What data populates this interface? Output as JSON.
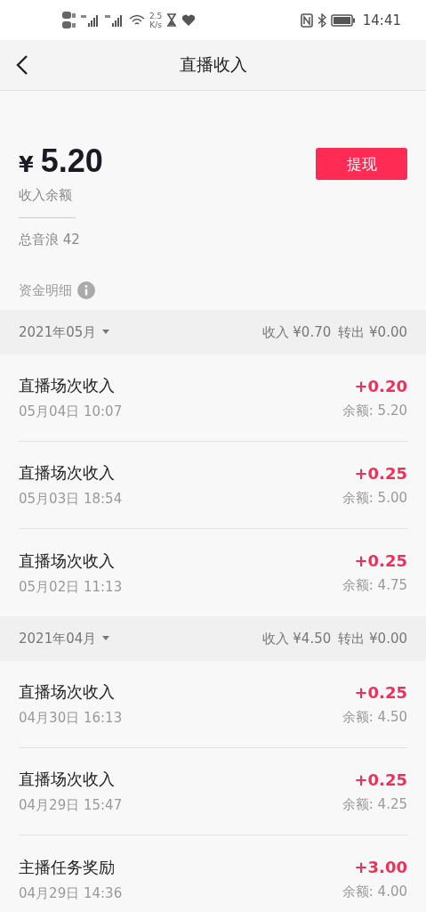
{
  "status_bar": {
    "speed_value": "2.5",
    "speed_unit": "K/s",
    "time": "14:41"
  },
  "nav": {
    "title": "直播收入"
  },
  "summary": {
    "currency": "¥",
    "amount": "5.20",
    "amount_label": "收入余额",
    "total_label": "总音浪 42",
    "withdraw_button": "提现"
  },
  "details": {
    "title": "资金明细"
  },
  "groups": [
    {
      "month": "2021年05月",
      "income": "收入 ¥0.70",
      "outgoing": "转出 ¥0.00",
      "items": [
        {
          "name": "直播场次收入",
          "time": "05月04日 10:07",
          "amount": "+0.20",
          "balance": "余额: 5.20"
        },
        {
          "name": "直播场次收入",
          "time": "05月03日 18:54",
          "amount": "+0.25",
          "balance": "余额: 5.00"
        },
        {
          "name": "直播场次收入",
          "time": "05月02日 11:13",
          "amount": "+0.25",
          "balance": "余额: 4.75"
        }
      ]
    },
    {
      "month": "2021年04月",
      "income": "收入 ¥4.50",
      "outgoing": "转出 ¥0.00",
      "items": [
        {
          "name": "直播场次收入",
          "time": "04月30日 16:13",
          "amount": "+0.25",
          "balance": "余额: 4.50"
        },
        {
          "name": "直播场次收入",
          "time": "04月29日 15:47",
          "amount": "+0.25",
          "balance": "余额: 4.25"
        },
        {
          "name": "主播任务奖励",
          "time": "04月29日 14:36",
          "amount": "+3.00",
          "balance": "余额: 4.00"
        }
      ]
    }
  ]
}
